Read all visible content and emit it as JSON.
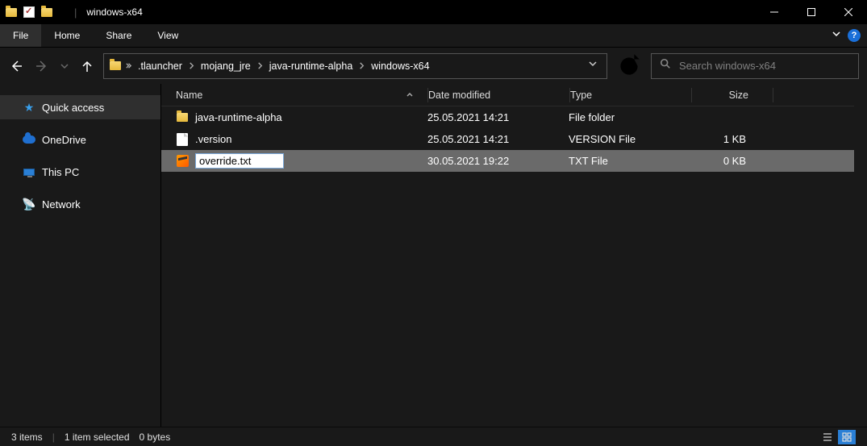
{
  "title": "windows-x64",
  "ribbon": {
    "file": "File",
    "home": "Home",
    "share": "Share",
    "view": "View",
    "help": "?"
  },
  "breadcrumbs": [
    ".tlauncher",
    "mojang_jre",
    "java-runtime-alpha",
    "windows-x64"
  ],
  "search": {
    "placeholder": "Search windows-x64"
  },
  "sidebar": {
    "quick_access": "Quick access",
    "onedrive": "OneDrive",
    "this_pc": "This PC",
    "network": "Network"
  },
  "columns": {
    "name": "Name",
    "date": "Date modified",
    "type": "Type",
    "size": "Size"
  },
  "rows": [
    {
      "icon": "folder",
      "name": "java-runtime-alpha",
      "date": "25.05.2021 14:21",
      "type": "File folder",
      "size": ""
    },
    {
      "icon": "file",
      "name": ".version",
      "date": "25.05.2021 14:21",
      "type": "VERSION File",
      "size": "1 KB"
    },
    {
      "icon": "sublime",
      "name": "override.txt",
      "date": "30.05.2021 19:22",
      "type": "TXT File",
      "size": "0 KB",
      "selected": true,
      "renaming": true
    }
  ],
  "status": {
    "count": "3 items",
    "selected": "1 item selected",
    "bytes": "0 bytes"
  }
}
